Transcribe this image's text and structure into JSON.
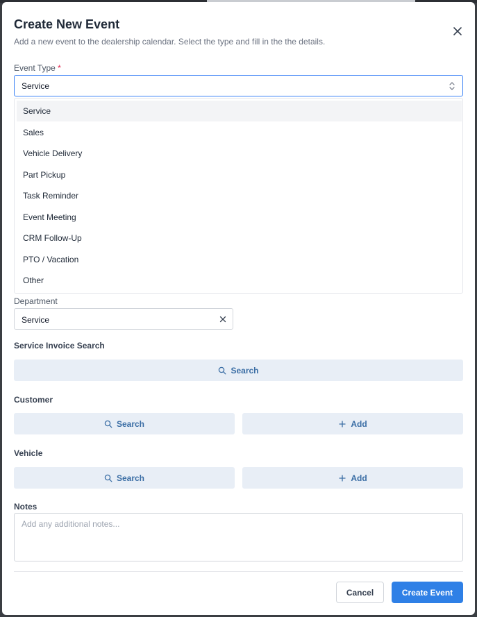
{
  "dialog": {
    "title": "Create New Event",
    "subtitle": "Add a new event to the dealership calendar. Select the type and fill in the the details.",
    "close_icon": "close-icon"
  },
  "event_type": {
    "label": "Event Type",
    "required_mark": "*",
    "value": "Service",
    "options": [
      "Service",
      "Sales",
      "Vehicle Delivery",
      "Part Pickup",
      "Task Reminder",
      "Event Meeting",
      "CRM Follow-Up",
      "PTO / Vacation",
      "Other"
    ],
    "highlighted_index": 0
  },
  "department": {
    "label": "Department",
    "value": "Service"
  },
  "service_invoice": {
    "label": "Service Invoice Search",
    "search_label": "Search"
  },
  "customer": {
    "label": "Customer",
    "search_label": "Search",
    "add_label": "Add"
  },
  "vehicle": {
    "label": "Vehicle",
    "search_label": "Search",
    "add_label": "Add"
  },
  "notes": {
    "label": "Notes",
    "placeholder": "Add any additional notes..."
  },
  "footer": {
    "cancel_label": "Cancel",
    "create_label": "Create Event"
  },
  "colors": {
    "accent": "#2f80e6",
    "required": "#e11d48",
    "secondary_button_bg": "#e8eef6",
    "secondary_button_text": "#3b6ea5"
  }
}
